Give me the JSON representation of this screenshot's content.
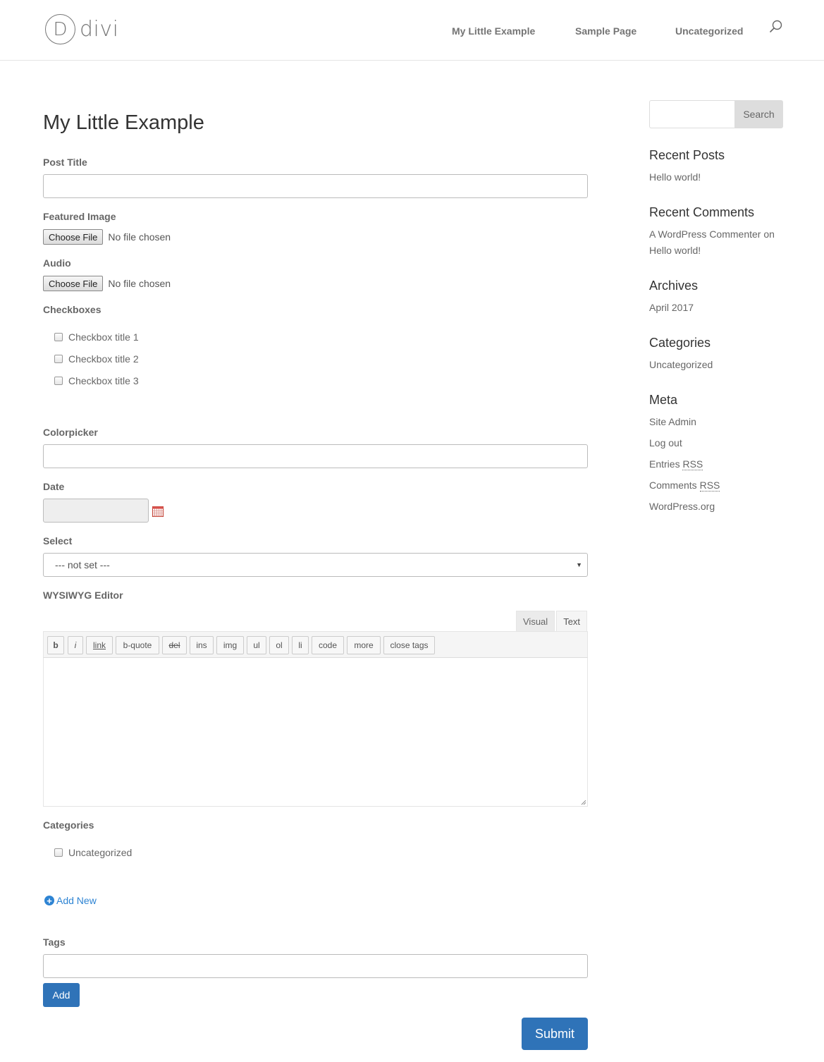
{
  "header": {
    "logo_letter": "D",
    "logo_text": "divi",
    "nav": [
      "My Little Example",
      "Sample Page",
      "Uncategorized"
    ]
  },
  "page": {
    "title": "My Little Example"
  },
  "form": {
    "post_title_label": "Post Title",
    "featured_image_label": "Featured Image",
    "audio_label": "Audio",
    "choose_file": "Choose File",
    "no_file": "No file chosen",
    "checkboxes_label": "Checkboxes",
    "checkboxes": [
      "Checkbox title 1",
      "Checkbox title 2",
      "Checkbox title 3"
    ],
    "colorpicker_label": "Colorpicker",
    "date_label": "Date",
    "select_label": "Select",
    "select_value": "--- not set ---",
    "wysiwyg_label": "WYSIWYG Editor",
    "editor_tabs": [
      "Visual",
      "Text"
    ],
    "toolbar": [
      "b",
      "i",
      "link",
      "b-quote",
      "del",
      "ins",
      "img",
      "ul",
      "ol",
      "li",
      "code",
      "more",
      "close tags"
    ],
    "categories_label": "Categories",
    "categories": [
      "Uncategorized"
    ],
    "add_new": "Add New",
    "tags_label": "Tags",
    "add_button": "Add",
    "submit_button": "Submit"
  },
  "sidebar": {
    "search_button": "Search",
    "recent_posts_heading": "Recent Posts",
    "recent_posts": [
      "Hello world!"
    ],
    "recent_comments_heading": "Recent Comments",
    "recent_comment_author": "A WordPress Commenter",
    "recent_comment_on": "on",
    "recent_comment_post": "Hello world!",
    "archives_heading": "Archives",
    "archives": [
      "April 2017"
    ],
    "categories_heading": "Categories",
    "categories": [
      "Uncategorized"
    ],
    "meta_heading": "Meta",
    "meta": {
      "site_admin": "Site Admin",
      "log_out": "Log out",
      "entries": "Entries",
      "comments": "Comments",
      "rss": "RSS",
      "wordpress_org": "WordPress.org"
    }
  }
}
